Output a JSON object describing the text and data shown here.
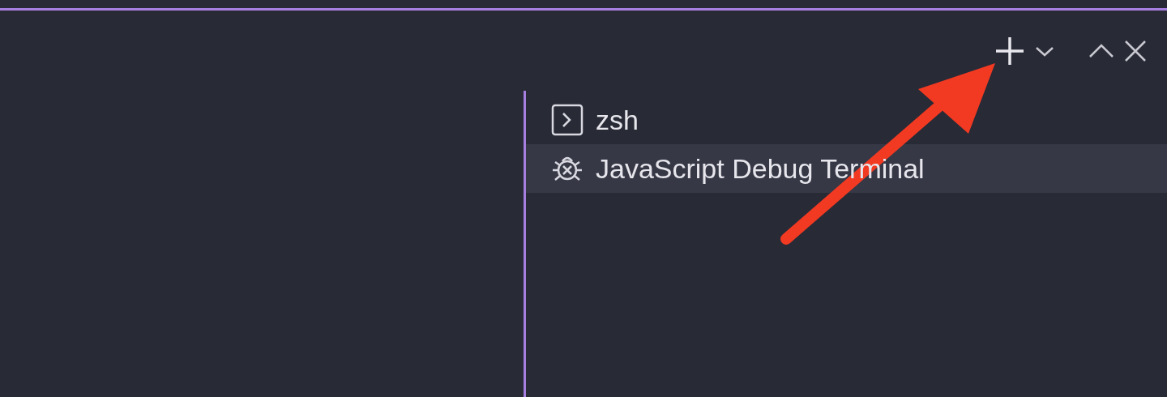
{
  "toolbar": {
    "buttons": [
      {
        "kind": "new"
      },
      {
        "kind": "dropdown"
      },
      {
        "kind": "maximize"
      },
      {
        "kind": "close"
      }
    ]
  },
  "terminals": [
    {
      "label": "zsh",
      "kind": "shell",
      "selected": false
    },
    {
      "label": "JavaScript Debug Terminal",
      "kind": "debug",
      "selected": true
    }
  ]
}
